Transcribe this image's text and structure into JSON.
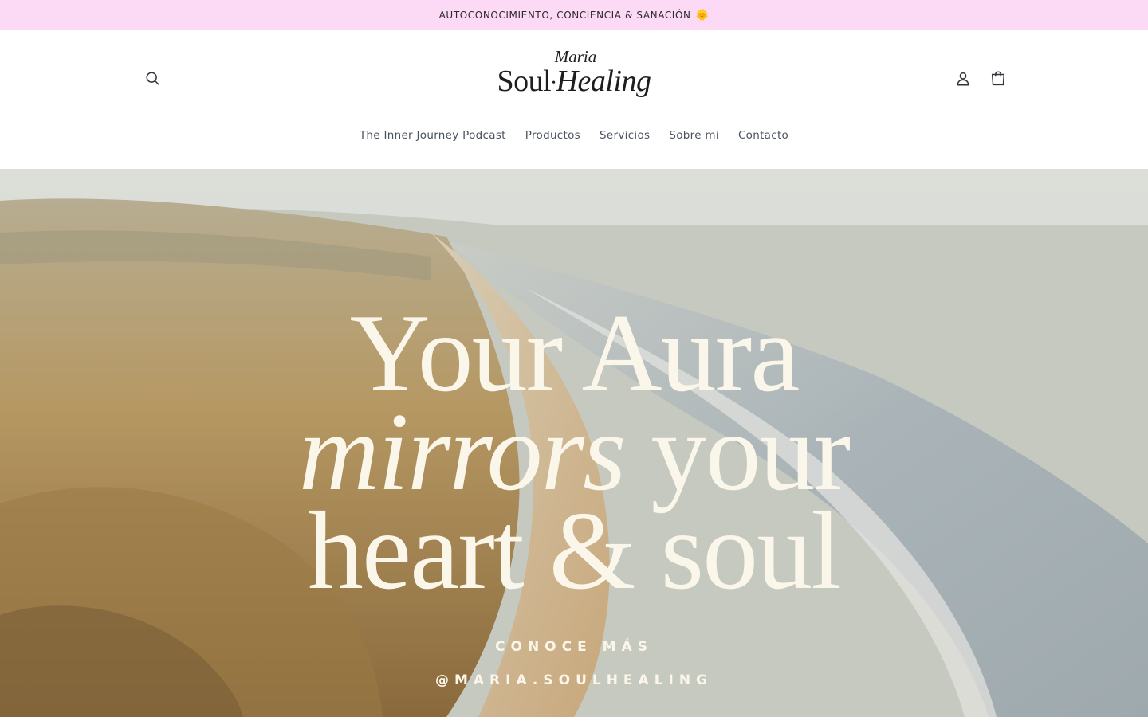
{
  "announcement": {
    "text": "AUTOCONOCIMIENTO, CONCIENCIA & SANACIÓN",
    "emoji": "🌞"
  },
  "header": {
    "logo": {
      "line1": "Maria",
      "soul": "Soul",
      "dot": "•",
      "healing": "Healing"
    },
    "icons": {
      "search": "search-icon",
      "account": "account-icon",
      "cart": "cart-icon"
    }
  },
  "nav": {
    "items": [
      {
        "label": "The Inner Journey Podcast"
      },
      {
        "label": "Productos"
      },
      {
        "label": "Servicios"
      },
      {
        "label": "Sobre mi"
      },
      {
        "label": "Contacto"
      }
    ]
  },
  "hero": {
    "headline_line1": "Your Aura",
    "headline_line2_italic": "mirrors",
    "headline_line2_rest": " your",
    "headline_line3": "heart & soul",
    "cta": "CONOCE MÁS",
    "handle": "@MARIA.SOULHEALING"
  },
  "colors": {
    "announcement_bg": "#fcd9f5",
    "hero_text": "#fbf6ea",
    "nav_text": "#4a5260"
  }
}
